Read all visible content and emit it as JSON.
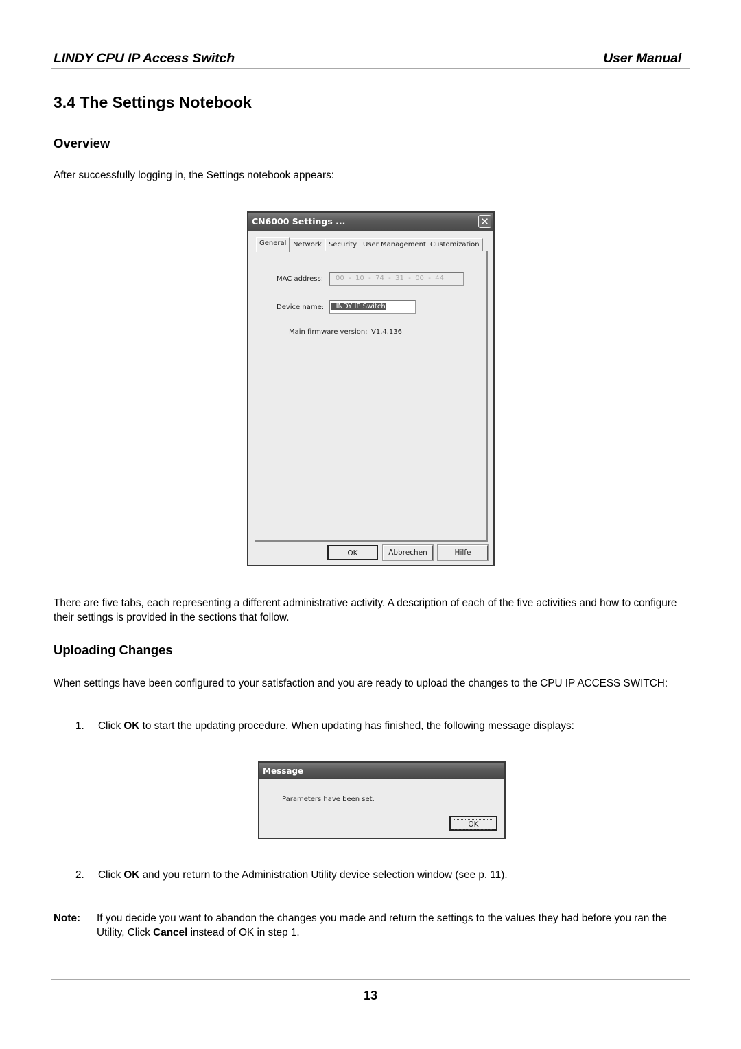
{
  "header": {
    "product": "LINDY CPU IP Access Switch",
    "doc_type": "User Manual"
  },
  "section": {
    "title": "3.4 The Settings Notebook"
  },
  "overview": {
    "heading": "Overview",
    "intro": "After successfully logging in, the Settings notebook appears:"
  },
  "settings_dialog": {
    "title": "CN6000 Settings ...",
    "close_label": "✕",
    "tabs": [
      {
        "label": "General",
        "active": true
      },
      {
        "label": "Network",
        "active": false
      },
      {
        "label": "Security",
        "active": false
      },
      {
        "label": "User Management",
        "active": false
      },
      {
        "label": "Customization",
        "active": false
      }
    ],
    "mac_label": "MAC address:",
    "mac_value": "00  -  10  -  74  -  31  -  00  -  44",
    "device_name_label": "Device name:",
    "device_name_value": "LINDY IP Switch",
    "firmware_label": "Main firmware version:",
    "firmware_value": "V1.4.136",
    "buttons": {
      "ok": "OK",
      "cancel": "Abbrechen",
      "help": "Hilfe"
    }
  },
  "tabs_description": "There are five tabs, each representing a different administrative activity. A description of each of the five activities and how to configure their settings is provided in the sections that follow.",
  "uploading": {
    "heading": "Uploading Changes",
    "intro": "When settings have been configured to your satisfaction and you are ready to upload the changes to the CPU IP ACCESS SWITCH:",
    "steps": [
      {
        "num": "1.",
        "pre": "Click ",
        "bold": "OK",
        "post": " to start the updating procedure. When updating has finished, the following message displays:"
      },
      {
        "num": "2.",
        "pre": "Click ",
        "bold": "OK",
        "post": " and you return to the Administration Utility device selection window (see p. 11)."
      }
    ]
  },
  "message_dialog": {
    "title": "Message",
    "text": "Parameters have been set.",
    "ok": "OK"
  },
  "note": {
    "label": "Note:",
    "pre": "If you decide you want to abandon the changes you made and return the settings to the values they had before you ran the Utility, Click ",
    "bold": "Cancel",
    "post": " instead of OK in step 1."
  },
  "footer": {
    "page_number": "13"
  }
}
